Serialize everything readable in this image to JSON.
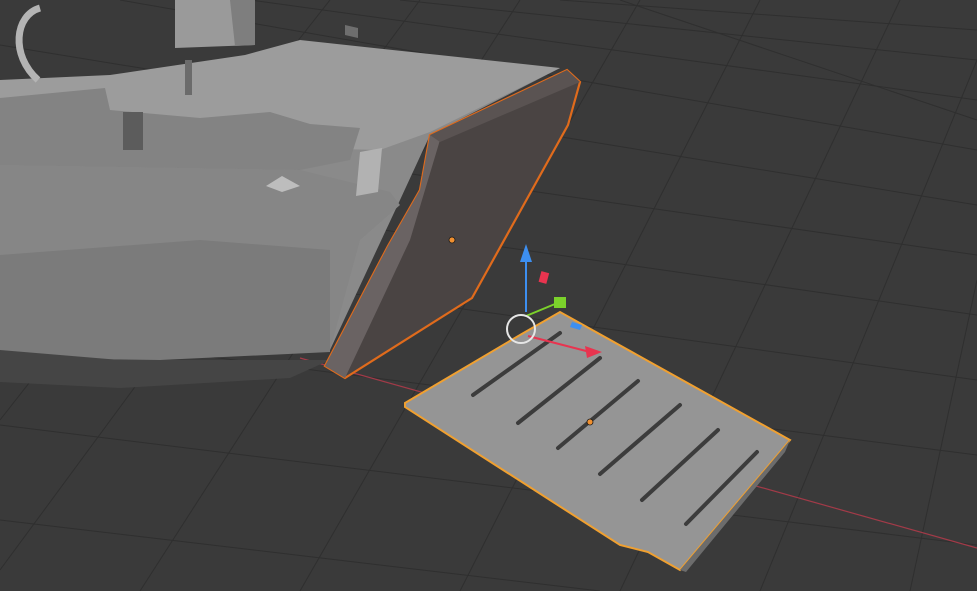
{
  "viewport": {
    "background": "#3a3a3a",
    "grid_line_color": "#2f2f2f",
    "x_axis_color": "#a23a48"
  },
  "scene": {
    "hull_object": {
      "icon": "boat-hull-mesh",
      "fill": "#8d8d8d",
      "shadow": "#5e5e5e"
    },
    "selected_panel": {
      "icon": "ramp-panel-mesh",
      "selected": true,
      "outline": "#e06b1c",
      "fill": "#4a4443"
    },
    "active_deck": {
      "icon": "deck-plate-mesh",
      "selected": true,
      "active": true,
      "outline": "#f0a030",
      "fill": "#959595"
    },
    "origin_dot_color": "#f09030",
    "cursor_3d": {
      "icon": "3d-cursor-circle",
      "color": "#e6e6e6"
    }
  },
  "gizmo": {
    "z_color": "#3d8ff0",
    "x_color": "#e8344f",
    "y_color": "#7bd12b"
  }
}
